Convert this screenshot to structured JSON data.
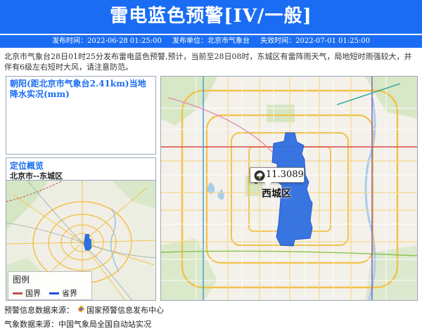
{
  "header": {
    "title": "雷电蓝色预警[IV/一般]",
    "publish_time": "发布时间：2022-06-28 01:25:00",
    "publisher": "发布单位：北京市气象台",
    "expire_time": "失效时间：2022-07-01 01:25:00"
  },
  "description": "北京市气象台28日01时25分发布雷电蓝色预警,预计，当前至28日08时，东城区有雷阵雨天气，局地短时雨强较大，并伴有6级左右短时大风，请注意防范。",
  "rain_panel": {
    "title": "朝阳(距北京市气象台2.41km)当地降水实况(mm)"
  },
  "location_panel": {
    "title": "定位概览",
    "region": "北京市--东城区"
  },
  "legend": {
    "title": "图例",
    "items": [
      {
        "label": "国界",
        "color": "#c0504d"
      },
      {
        "label": "省界",
        "color": "#1f4fd8"
      }
    ]
  },
  "map": {
    "callout_value": "11.3089",
    "district_label": "西城区",
    "highlight_color": "#2f6fe0"
  },
  "footer": {
    "warning_source_label": "预警信息数据来源：",
    "warning_source": "国家预警信息发布中心",
    "weather_source": "气象数据来源：中国气象局全国自动站实况"
  },
  "colors": {
    "banner": "#1a6df2",
    "title_blue": "#1a6df2"
  }
}
